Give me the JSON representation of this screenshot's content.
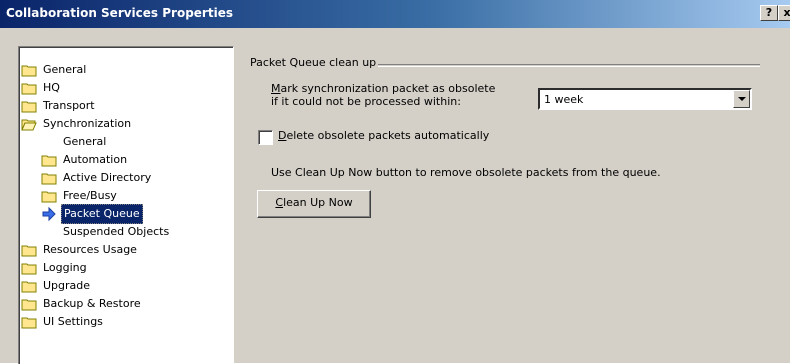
{
  "window": {
    "title": "Collaboration Services Properties",
    "help_label": "?",
    "close_label": "x"
  },
  "tree": {
    "items": [
      {
        "label": "General"
      },
      {
        "label": "HQ"
      },
      {
        "label": "Transport"
      },
      {
        "label": "Synchronization"
      },
      {
        "label": "General"
      },
      {
        "label": "Automation"
      },
      {
        "label": "Active Directory"
      },
      {
        "label": "Free/Busy"
      },
      {
        "label": "Packet Queue",
        "selected": true
      },
      {
        "label": "Suspended Objects"
      },
      {
        "label": "Resources Usage"
      },
      {
        "label": "Logging"
      },
      {
        "label": "Upgrade"
      },
      {
        "label": "Backup & Restore"
      },
      {
        "label": "UI Settings"
      }
    ]
  },
  "panel": {
    "group_title": "Packet Queue clean up",
    "obsolete_label_line1_key": "M",
    "obsolete_label_line1_rest": "ark synchronization packet as obsolete",
    "obsolete_label_line2": "if it could not be processed within:",
    "obsolete_value": "1 week",
    "delete_label_key": "D",
    "delete_label_rest": "elete obsolete packets automatically",
    "delete_checked": false,
    "info_text": "Use Clean Up Now button to remove obsolete packets from the queue.",
    "cleanup_button_key": "C",
    "cleanup_button_rest": "lean Up Now"
  },
  "colors": {
    "title_bar": "#0a246a",
    "dialog_face": "#d4d0c8",
    "selection": "#0a246a"
  }
}
